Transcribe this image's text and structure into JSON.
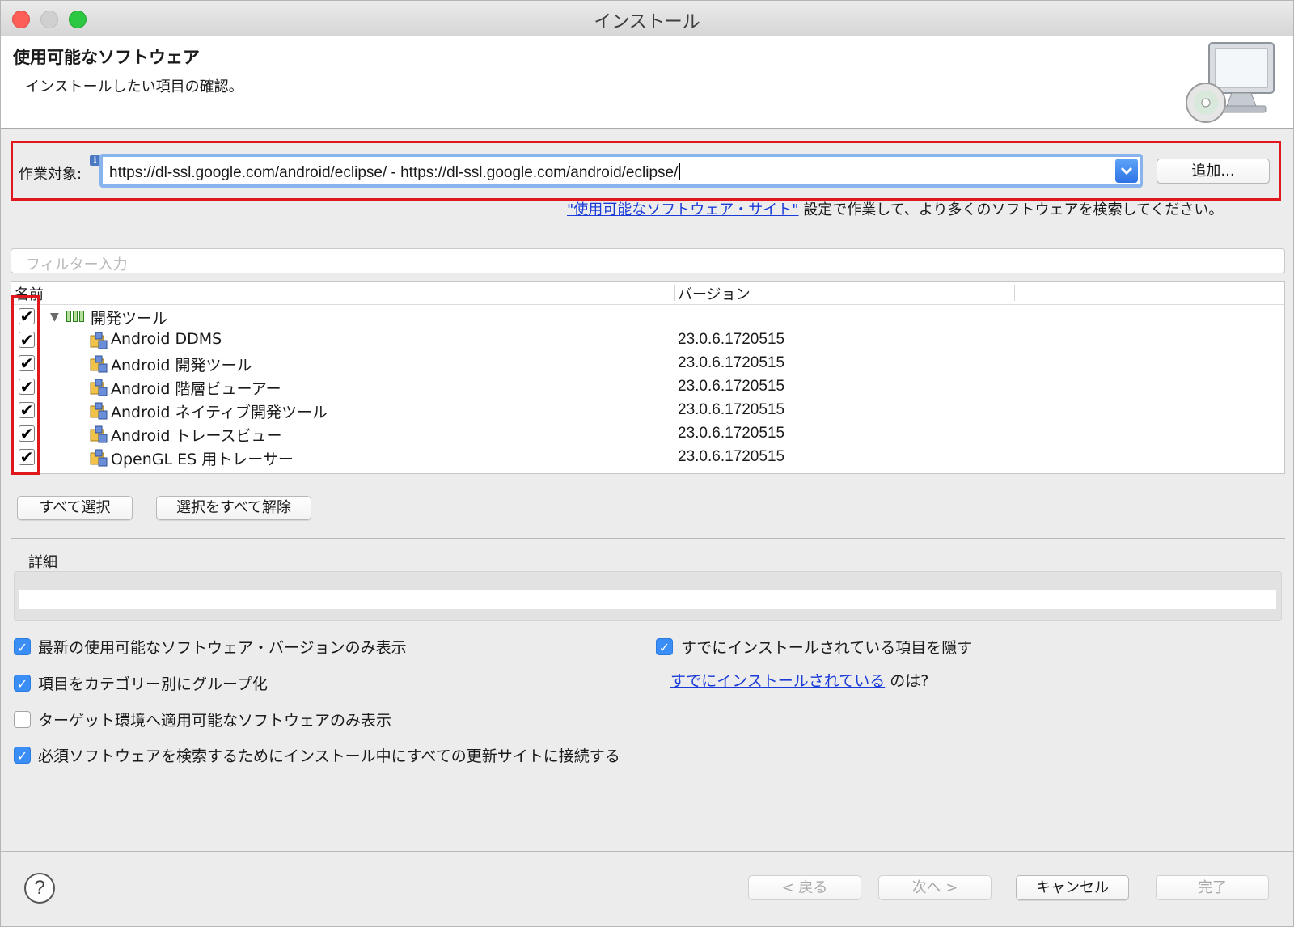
{
  "window": {
    "title": "インストール"
  },
  "header": {
    "title": "使用可能なソフトウェア",
    "subtitle": "インストールしたい項目の確認。",
    "icon": "cd-computer-icon"
  },
  "work": {
    "label": "作業対象:",
    "value": "https://dl-ssl.google.com/android/eclipse/ - https://dl-ssl.google.com/android/eclipse/",
    "add_button": "追加...",
    "site_link": "\"使用可能なソフトウェア・サイト\"",
    "site_text": " 設定で作業して、より多くのソフトウェアを検索してください。"
  },
  "filter": {
    "placeholder": "フィルター入力"
  },
  "table": {
    "col_name": "名前",
    "col_version": "バージョン",
    "category": {
      "label": "開発ツール",
      "checked": true,
      "expanded": true
    },
    "items": [
      {
        "name": "Android DDMS",
        "version": "23.0.6.1720515",
        "checked": true
      },
      {
        "name": "Android 開発ツール",
        "version": "23.0.6.1720515",
        "checked": true
      },
      {
        "name": "Android 階層ビューアー",
        "version": "23.0.6.1720515",
        "checked": true
      },
      {
        "name": "Android ネイティブ開発ツール",
        "version": "23.0.6.1720515",
        "checked": true
      },
      {
        "name": "Android トレースビュー",
        "version": "23.0.6.1720515",
        "checked": true
      },
      {
        "name": "OpenGL ES 用トレーサー",
        "version": "23.0.6.1720515",
        "checked": true
      }
    ]
  },
  "buttons": {
    "select_all": "すべて選択",
    "deselect_all": "選択をすべて解除"
  },
  "details": {
    "label": "詳細"
  },
  "options": {
    "latest_only": {
      "label": "最新の使用可能なソフトウェア・バージョンのみ表示",
      "checked": true
    },
    "group_by_category": {
      "label": "項目をカテゴリー別にグループ化",
      "checked": true
    },
    "target_only": {
      "label": "ターゲット環境へ適用可能なソフトウェアのみ表示",
      "checked": false
    },
    "contact_all_sites": {
      "label": "必須ソフトウェアを検索するためにインストール中にすべての更新サイトに接続する",
      "checked": true
    },
    "hide_installed": {
      "label": "すでにインストールされている項目を隠す",
      "checked": true
    },
    "already_installed_link": "すでにインストールされている",
    "already_installed_suffix": " のは?"
  },
  "footer": {
    "back": "< 戻る",
    "next": "次へ >",
    "cancel": "キャンセル",
    "finish": "完了"
  },
  "colors": {
    "highlight": "#e0171d",
    "link": "#1a3bd8",
    "checkbox_on": "#3a8ef6"
  }
}
